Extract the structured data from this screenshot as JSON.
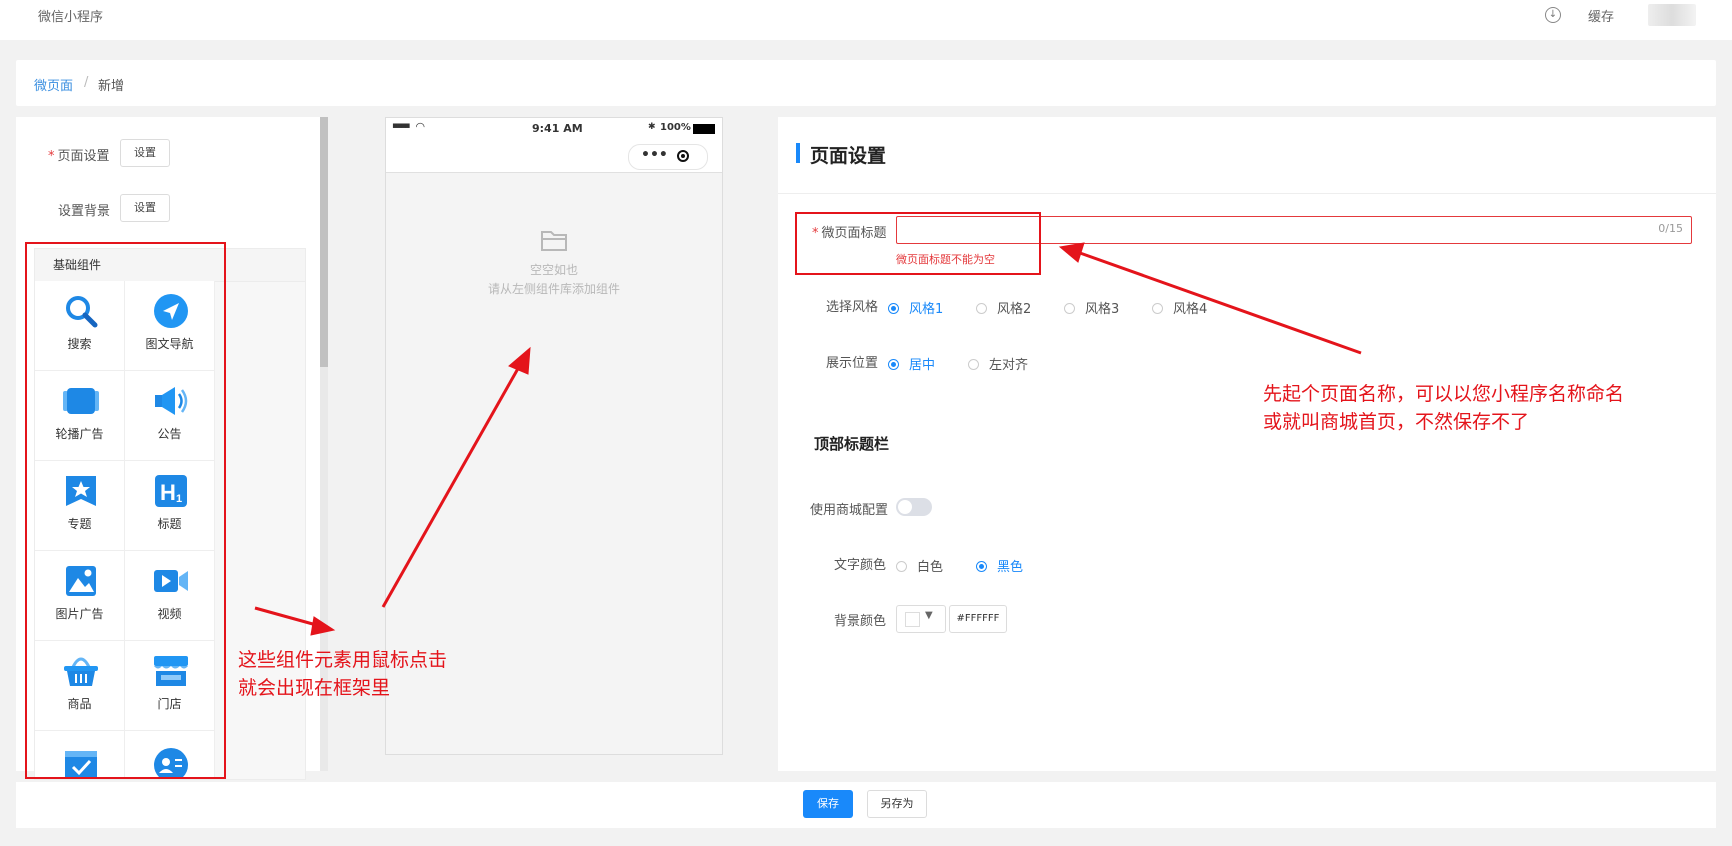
{
  "topbar": {
    "app_name": "微信小程序",
    "cache_label": "缓存",
    "download_icon": "download-circle-icon"
  },
  "breadcrumb": {
    "parent": "微页面",
    "separator": "/",
    "current": "新增"
  },
  "left_panel": {
    "page_settings_label": "页面设置",
    "page_settings_button": "设置",
    "background_label": "设置背景",
    "background_button": "设置",
    "components_header": "基础组件",
    "components": [
      {
        "label": "搜索",
        "icon": "search-icon"
      },
      {
        "label": "图文导航",
        "icon": "navigation-icon"
      },
      {
        "label": "轮播广告",
        "icon": "carousel-icon"
      },
      {
        "label": "公告",
        "icon": "announcement-icon"
      },
      {
        "label": "专题",
        "icon": "topic-icon"
      },
      {
        "label": "标题",
        "icon": "heading-icon"
      },
      {
        "label": "图片广告",
        "icon": "image-ad-icon"
      },
      {
        "label": "视频",
        "icon": "video-icon"
      },
      {
        "label": "商品",
        "icon": "basket-icon"
      },
      {
        "label": "门店",
        "icon": "store-icon"
      },
      {
        "label": "",
        "icon": "calendar-check-icon"
      },
      {
        "label": "",
        "icon": "contact-card-icon"
      }
    ]
  },
  "phone": {
    "signal": "▪▪▪▪",
    "time": "9:41 AM",
    "battery": "100%",
    "bluetooth": "✱",
    "empty_title": "空空如也",
    "empty_hint": "请从左侧组件库添加组件"
  },
  "right_panel": {
    "title": "页面设置",
    "page_title_label": "微页面标题",
    "page_title_value": "",
    "page_title_count": "0/15",
    "page_title_error": "微页面标题不能为空",
    "style_label": "选择风格",
    "styles": [
      "风格1",
      "风格2",
      "风格3",
      "风格4"
    ],
    "style_selected": "风格1",
    "position_label": "展示位置",
    "positions": [
      "居中",
      "左对齐"
    ],
    "position_selected": "居中",
    "top_bar_section": "顶部标题栏",
    "use_mall_config_label": "使用商城配置",
    "use_mall_config": false,
    "text_color_label": "文字颜色",
    "text_colors": [
      "白色",
      "黑色"
    ],
    "text_color_selected": "黑色",
    "bg_color_label": "背景颜色",
    "bg_color_value": "#FFFFFF"
  },
  "footer": {
    "save": "保存",
    "save_as": "另存为"
  },
  "annotations": {
    "left_note_line1": "这些组件元素用鼠标点击",
    "left_note_line2": "就会出现在框架里",
    "right_note_line1": "先起个页面名称，可以以您小程序名称命名",
    "right_note_line2": "或就叫商城首页，不然保存不了"
  },
  "colors": {
    "accent": "#1989fa",
    "error": "#e4393c",
    "annotation": "#e4141b"
  }
}
